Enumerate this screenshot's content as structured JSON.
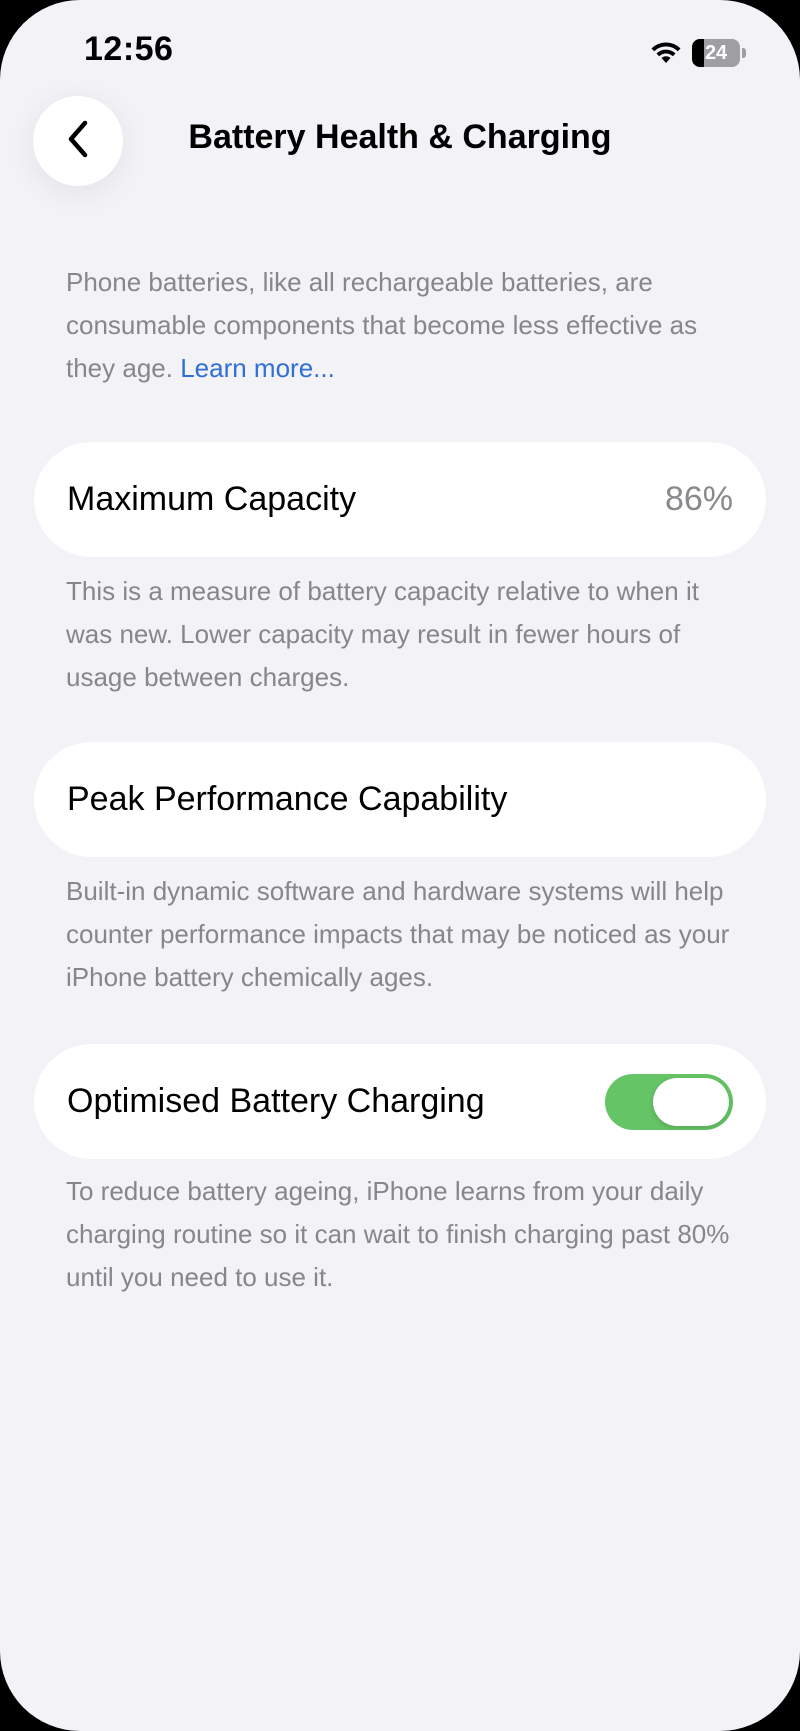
{
  "status_bar": {
    "time": "12:56",
    "battery_level": "24",
    "icons": [
      "wifi-icon",
      "battery-icon"
    ]
  },
  "nav": {
    "back_icon": "chevron-left-icon",
    "title": "Battery Health & Charging"
  },
  "intro": {
    "text": "Phone batteries, like all rechargeable batteries, are consumable components that become less effective as they age. ",
    "link": "Learn more..."
  },
  "max_capacity": {
    "label": "Maximum Capacity",
    "value": "86%",
    "description": "This is a measure of battery capacity relative to when it was new. Lower capacity may result in fewer hours of usage between charges."
  },
  "peak_performance": {
    "label": "Peak Performance Capability",
    "description": "Built-in dynamic software and hardware systems will help counter performance impacts that may be noticed as your iPhone battery chemically ages."
  },
  "optimised_charging": {
    "label": "Optimised Battery Charging",
    "enabled": true,
    "description": "To reduce battery ageing, iPhone learns from your daily charging routine so it can wait to finish charging past 80% until you need to use it."
  },
  "colors": {
    "background": "#F2F2F7",
    "card": "#FFFFFF",
    "secondary_text": "#86868B",
    "link": "#2F6FD6",
    "toggle_on": "#65C466"
  }
}
